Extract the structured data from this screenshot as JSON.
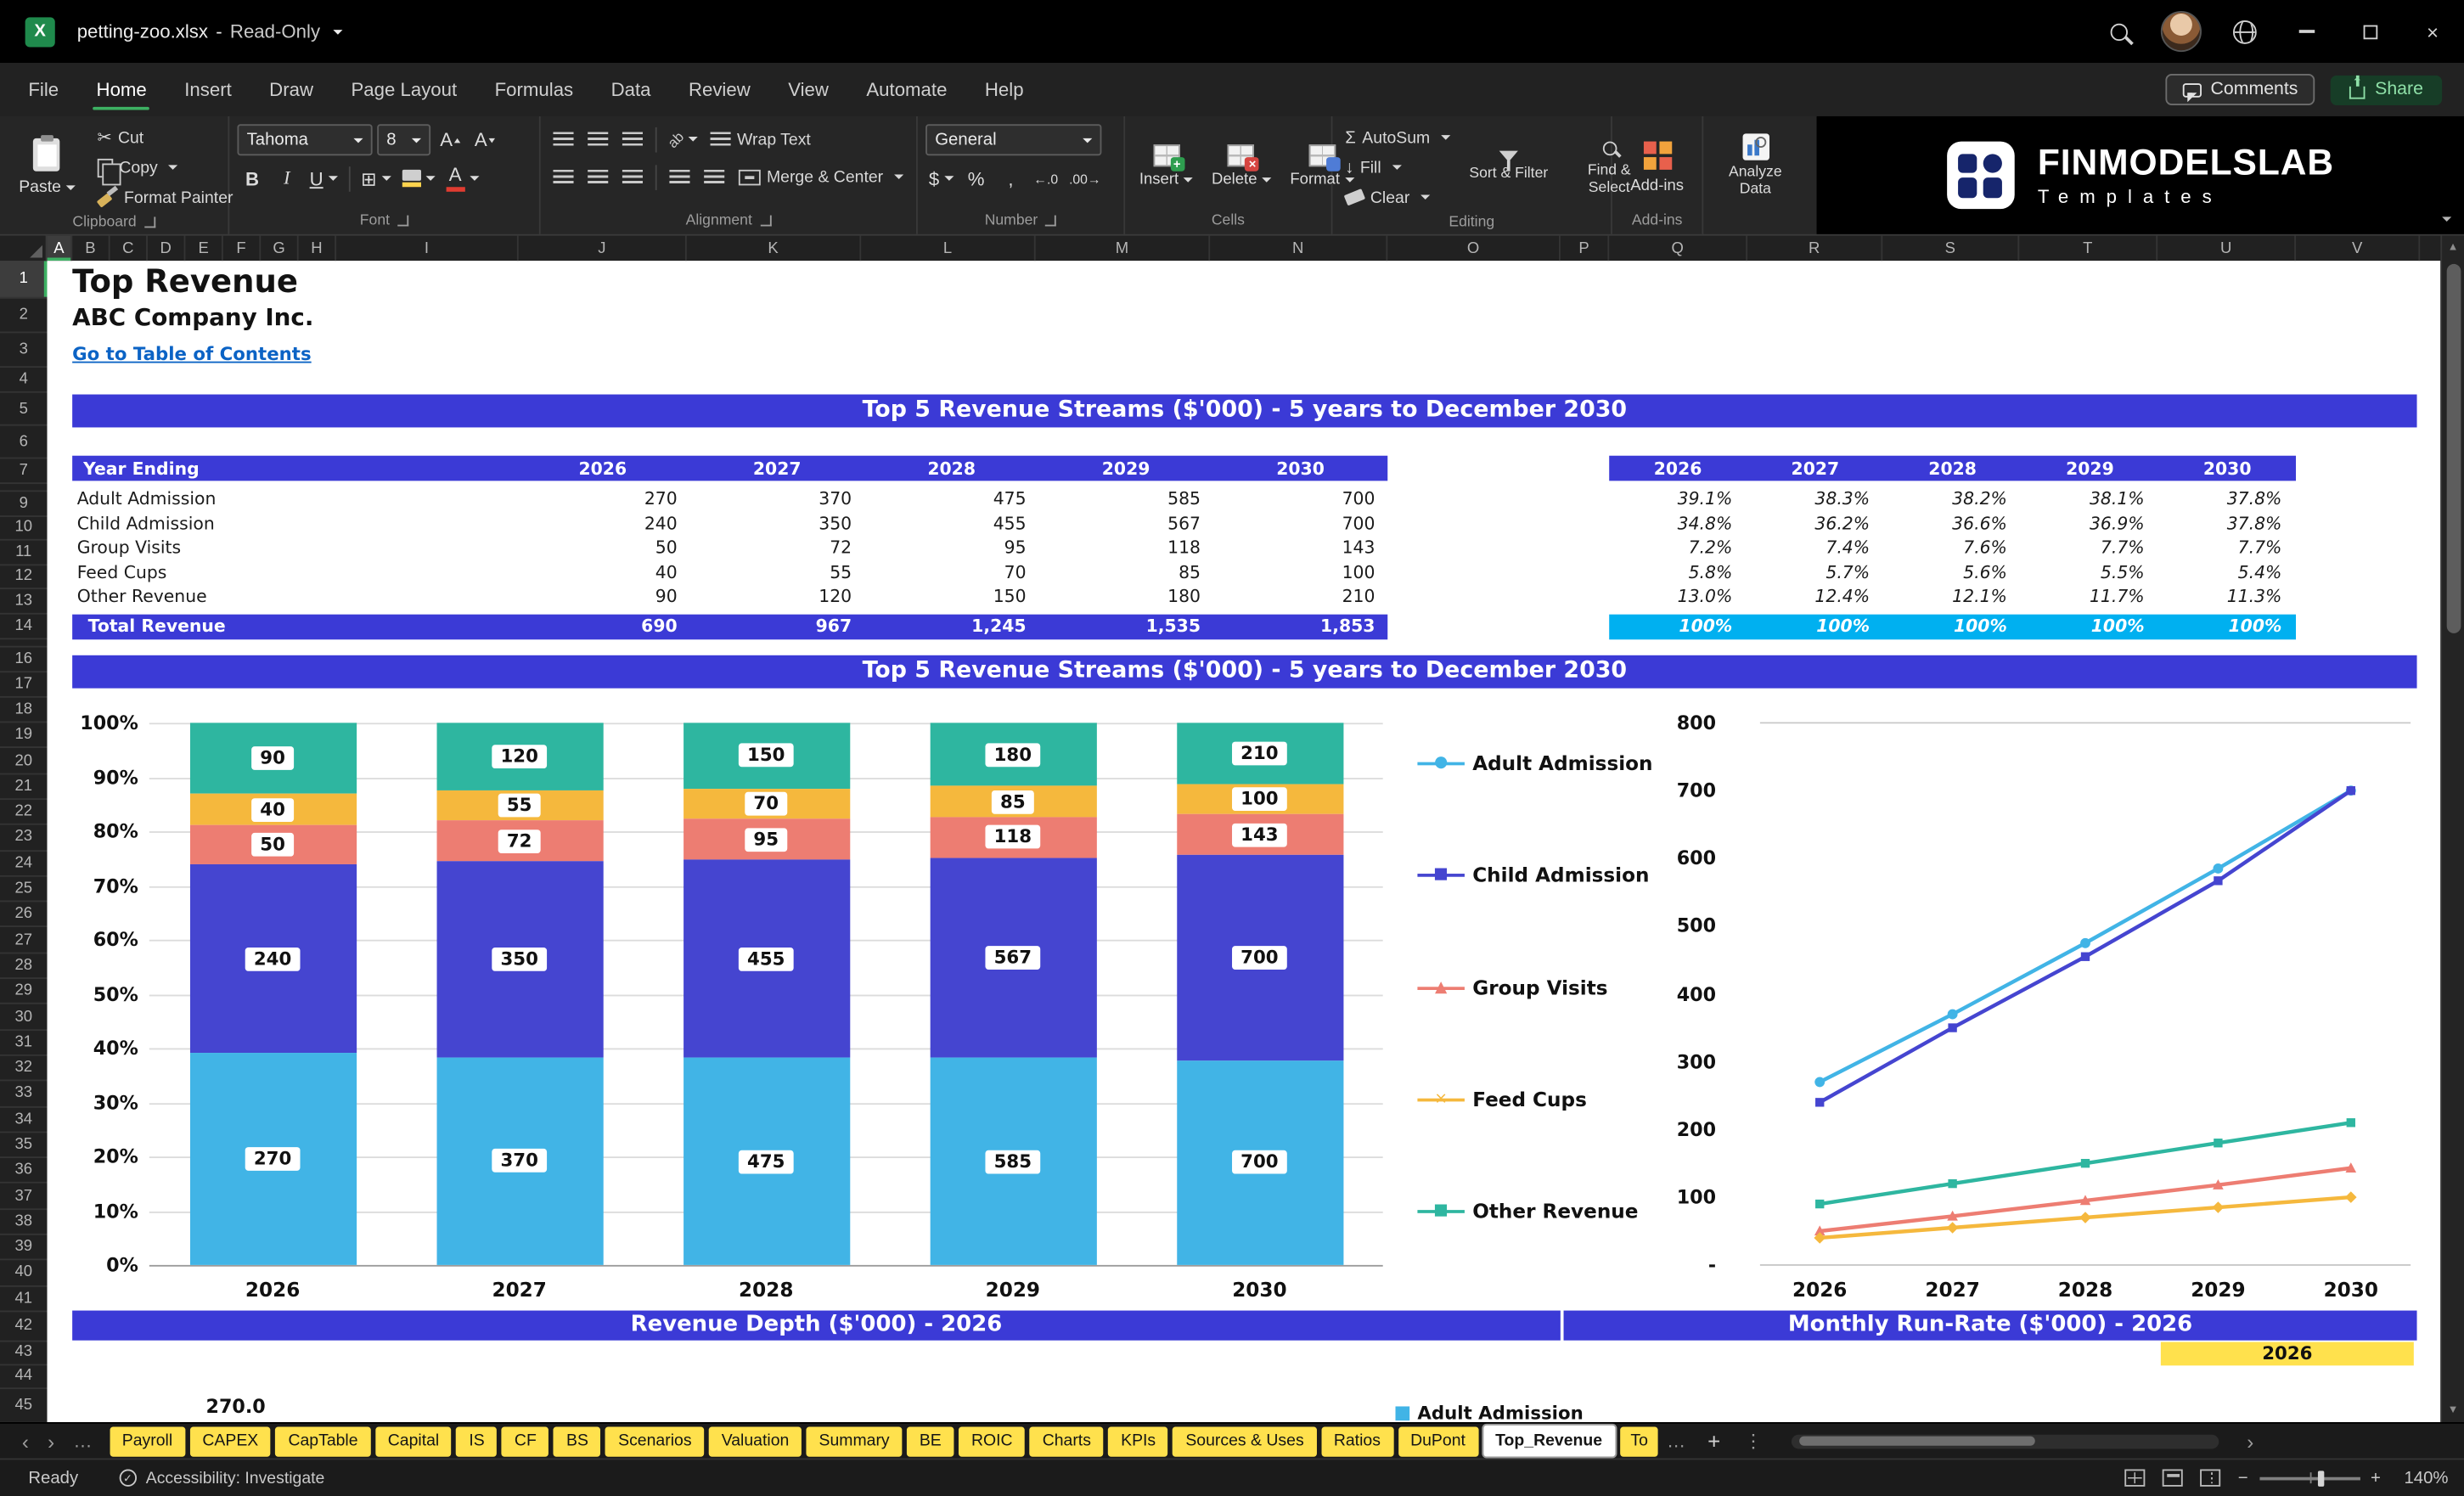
{
  "window": {
    "file_name": "petting-zoo.xlsx",
    "mode": "Read-Only"
  },
  "menu": {
    "items": [
      "File",
      "Home",
      "Insert",
      "Draw",
      "Page Layout",
      "Formulas",
      "Data",
      "Review",
      "View",
      "Automate",
      "Help"
    ],
    "active_item": "Home",
    "comments_label": "Comments",
    "share_label": "Share"
  },
  "ribbon": {
    "clipboard": {
      "label": "Clipboard",
      "paste": "Paste",
      "cut": "Cut",
      "copy": "Copy",
      "format_painter": "Format Painter"
    },
    "font": {
      "label": "Font",
      "family": "Tahoma",
      "size": "8",
      "bold": "B",
      "italic": "I",
      "underline": "U"
    },
    "alignment": {
      "label": "Alignment",
      "wrap_text": "Wrap Text",
      "merge_center": "Merge & Center"
    },
    "number": {
      "label": "Number",
      "format": "General",
      "currency": "$",
      "percent": "%",
      "comma": ","
    },
    "cells": {
      "label": "Cells",
      "insert": "Insert",
      "delete": "Delete",
      "format": "Format"
    },
    "editing": {
      "label": "Editing",
      "autosum": "AutoSum",
      "fill": "Fill",
      "clear": "Clear",
      "sort_filter": "Sort & Filter",
      "find_select": "Find & Select"
    },
    "addins": {
      "label": "Add-ins",
      "button": "Add-ins",
      "analyze": "Analyze Data"
    },
    "brand": {
      "name": "FINMODELSLAB",
      "sub": "Templates"
    }
  },
  "icons": {
    "excel_x": "X",
    "scissors": "✂",
    "sigma": "Σ",
    "down_arrow": "↓",
    "borders_glyph": "⊞",
    "orientation_glyph": "ab",
    "close_x": "×",
    "inc_decimal": "←.0",
    "dec_decimal": ".00→",
    "chevron_left": "‹",
    "chevron_right": "›",
    "ellipsis": "…",
    "dots_vertical": "⋮",
    "triangle_up": "▲",
    "triangle_down": "▼",
    "check": "✓",
    "plus": "+",
    "minus": "−",
    "font_color_a": "A",
    "increase_font": "A",
    "decrease_font": "A"
  },
  "colors": {
    "banner_blue": "#3B3AD6",
    "total_cyan": "#00B0F0",
    "tab_yellow": "#FFE14D",
    "accent_green": "#3DB163",
    "link_blue": "#0B63C5"
  },
  "grid": {
    "columns": [
      {
        "l": "A",
        "w": 16
      },
      {
        "l": "B",
        "w": 24
      },
      {
        "l": "C",
        "w": 24
      },
      {
        "l": "D",
        "w": 24
      },
      {
        "l": "E",
        "w": 24
      },
      {
        "l": "F",
        "w": 24
      },
      {
        "l": "G",
        "w": 24
      },
      {
        "l": "H",
        "w": 24
      },
      {
        "l": "I",
        "w": 116
      },
      {
        "l": "J",
        "w": 107
      },
      {
        "l": "K",
        "w": 111
      },
      {
        "l": "L",
        "w": 111
      },
      {
        "l": "M",
        "w": 111
      },
      {
        "l": "N",
        "w": 113
      },
      {
        "l": "O",
        "w": 110
      },
      {
        "l": "P",
        "w": 31
      },
      {
        "l": "Q",
        "w": 88
      },
      {
        "l": "R",
        "w": 86
      },
      {
        "l": "S",
        "w": 87
      },
      {
        "l": "T",
        "w": 88
      },
      {
        "l": "U",
        "w": 88
      },
      {
        "l": "V",
        "w": 79
      }
    ],
    "rows": [
      {
        "n": "1",
        "h": 24
      },
      {
        "n": "2",
        "h": 22
      },
      {
        "n": "3",
        "h": 22
      },
      {
        "n": "4",
        "h": 16
      },
      {
        "n": "5",
        "h": 21
      },
      {
        "n": "6",
        "h": 21
      },
      {
        "n": "7",
        "h": 16
      },
      {
        "n": "",
        "h": 5
      },
      {
        "n": "9",
        "h": 15.5
      },
      {
        "n": "10",
        "h": 15.5
      },
      {
        "n": "11",
        "h": 15.5
      },
      {
        "n": "12",
        "h": 15.5
      },
      {
        "n": "13",
        "h": 15.5
      },
      {
        "n": "14",
        "h": 16
      },
      {
        "n": "",
        "h": 5
      },
      {
        "n": "16",
        "h": 16
      },
      {
        "n": "17",
        "h": 16.3
      },
      {
        "n": "18",
        "h": 16.3
      },
      {
        "n": "19",
        "h": 16.3
      },
      {
        "n": "20",
        "h": 16.3
      },
      {
        "n": "21",
        "h": 16.3
      },
      {
        "n": "22",
        "h": 16.3
      },
      {
        "n": "23",
        "h": 16.3
      },
      {
        "n": "24",
        "h": 16.3
      },
      {
        "n": "25",
        "h": 16.3
      },
      {
        "n": "26",
        "h": 16.3
      },
      {
        "n": "27",
        "h": 16.3
      },
      {
        "n": "28",
        "h": 16.3
      },
      {
        "n": "29",
        "h": 16.3
      },
      {
        "n": "30",
        "h": 16.3
      },
      {
        "n": "31",
        "h": 16.3
      },
      {
        "n": "32",
        "h": 16.3
      },
      {
        "n": "33",
        "h": 16.3
      },
      {
        "n": "34",
        "h": 16.3
      },
      {
        "n": "35",
        "h": 16.3
      },
      {
        "n": "36",
        "h": 16.3
      },
      {
        "n": "37",
        "h": 16.3
      },
      {
        "n": "38",
        "h": 16.3
      },
      {
        "n": "39",
        "h": 16.3
      },
      {
        "n": "40",
        "h": 16.3
      },
      {
        "n": "41",
        "h": 16.3
      },
      {
        "n": "42",
        "h": 19
      },
      {
        "n": "43",
        "h": 15
      },
      {
        "n": "44",
        "h": 15
      },
      {
        "n": "45",
        "h": 22
      }
    ]
  },
  "sheet": {
    "title": "Top Revenue",
    "company": "ABC Company Inc.",
    "toc_link": "Go to Table of Contents",
    "banner_top": "Top 5 Revenue Streams ($'000) - 5 years to December 2030",
    "banner_chart": "Top 5 Revenue Streams ($'000) - 5 years to December 2030",
    "banner_depth": "Revenue Depth ($'000) - 2026",
    "banner_runrate": "Monthly Run-Rate ($'000) - 2026",
    "runrate_year_cell": "2026",
    "depth_axis_value": "270.0",
    "depth_legend_item": "Adult Admission"
  },
  "table": {
    "header_label": "Year Ending",
    "years": [
      "2026",
      "2027",
      "2028",
      "2029",
      "2030"
    ],
    "rows": [
      {
        "label": "Adult Admission",
        "values": [
          "270",
          "370",
          "475",
          "585",
          "700"
        ],
        "pcts": [
          "39.1%",
          "38.3%",
          "38.2%",
          "38.1%",
          "37.8%"
        ]
      },
      {
        "label": "Child Admission",
        "values": [
          "240",
          "350",
          "455",
          "567",
          "700"
        ],
        "pcts": [
          "34.8%",
          "36.2%",
          "36.6%",
          "36.9%",
          "37.8%"
        ]
      },
      {
        "label": "Group Visits",
        "values": [
          "50",
          "72",
          "95",
          "118",
          "143"
        ],
        "pcts": [
          "7.2%",
          "7.4%",
          "7.6%",
          "7.7%",
          "7.7%"
        ]
      },
      {
        "label": "Feed Cups",
        "values": [
          "40",
          "55",
          "70",
          "85",
          "100"
        ],
        "pcts": [
          "5.8%",
          "5.7%",
          "5.6%",
          "5.5%",
          "5.4%"
        ]
      },
      {
        "label": "Other Revenue",
        "values": [
          "90",
          "120",
          "150",
          "180",
          "210"
        ],
        "pcts": [
          "13.0%",
          "12.4%",
          "12.1%",
          "11.7%",
          "11.3%"
        ]
      }
    ],
    "total": {
      "label": "Total Revenue",
      "values": [
        "690",
        "967",
        "1,245",
        "1,535",
        "1,853"
      ],
      "pcts": [
        "100%",
        "100%",
        "100%",
        "100%",
        "100%"
      ]
    }
  },
  "chart_data": [
    {
      "type": "bar",
      "subtype": "stacked-100pct",
      "title": "Top 5 Revenue Streams ($'000) - 5 years to December 2030",
      "categories": [
        "2026",
        "2027",
        "2028",
        "2029",
        "2030"
      ],
      "series": [
        {
          "name": "Adult Admission",
          "values": [
            270,
            370,
            475,
            585,
            700
          ],
          "color": "#41B4E6",
          "marker": "●"
        },
        {
          "name": "Child Admission",
          "values": [
            240,
            350,
            455,
            567,
            700
          ],
          "color": "#4545D0",
          "marker": "■"
        },
        {
          "name": "Group Visits",
          "values": [
            50,
            72,
            95,
            118,
            143
          ],
          "color": "#ED7D72",
          "marker": "▲"
        },
        {
          "name": "Feed Cups",
          "values": [
            40,
            55,
            70,
            85,
            100
          ],
          "color": "#F5B83D",
          "marker": "×"
        },
        {
          "name": "Other Revenue",
          "values": [
            90,
            120,
            150,
            180,
            210
          ],
          "color": "#2EB6A0",
          "marker": "■"
        }
      ],
      "y_tick_labels": [
        "100%",
        "90%",
        "80%",
        "70%",
        "60%",
        "50%",
        "40%",
        "30%",
        "20%",
        "10%",
        "0%"
      ],
      "ylim": [
        0,
        100
      ],
      "grid": true,
      "legend_position": "right"
    },
    {
      "type": "line",
      "categories": [
        "2026",
        "2027",
        "2028",
        "2029",
        "2030"
      ],
      "series": [
        {
          "name": "Adult Admission",
          "values": [
            270,
            370,
            475,
            585,
            700
          ],
          "color": "#41B4E6",
          "marker": "●"
        },
        {
          "name": "Child Admission",
          "values": [
            240,
            350,
            455,
            567,
            700
          ],
          "color": "#4545D0",
          "marker": "■"
        },
        {
          "name": "Group Visits",
          "values": [
            50,
            72,
            95,
            118,
            143
          ],
          "color": "#ED7D72",
          "marker": "▲"
        },
        {
          "name": "Feed Cups",
          "values": [
            40,
            55,
            70,
            85,
            100
          ],
          "color": "#F5B83D",
          "marker": "×"
        },
        {
          "name": "Other Revenue",
          "values": [
            90,
            120,
            150,
            180,
            210
          ],
          "color": "#2EB6A0",
          "marker": "■"
        }
      ],
      "y_tick_labels": [
        "800",
        "700",
        "600",
        "500",
        "400",
        "300",
        "200",
        "100",
        "-"
      ],
      "ylim": [
        0,
        800
      ],
      "grid": false
    }
  ],
  "tabs": {
    "items": [
      "Payroll",
      "CAPEX",
      "CapTable",
      "Capital",
      "IS",
      "CF",
      "BS",
      "Scenarios",
      "Valuation",
      "Summary",
      "BE",
      "ROIC",
      "Charts",
      "KPIs",
      "Sources & Uses",
      "Ratios",
      "DuPont",
      "Top_Revenue",
      "To"
    ],
    "active": "Top_Revenue"
  },
  "status": {
    "ready": "Ready",
    "accessibility": "Accessibility: Investigate",
    "zoom": "140%"
  }
}
